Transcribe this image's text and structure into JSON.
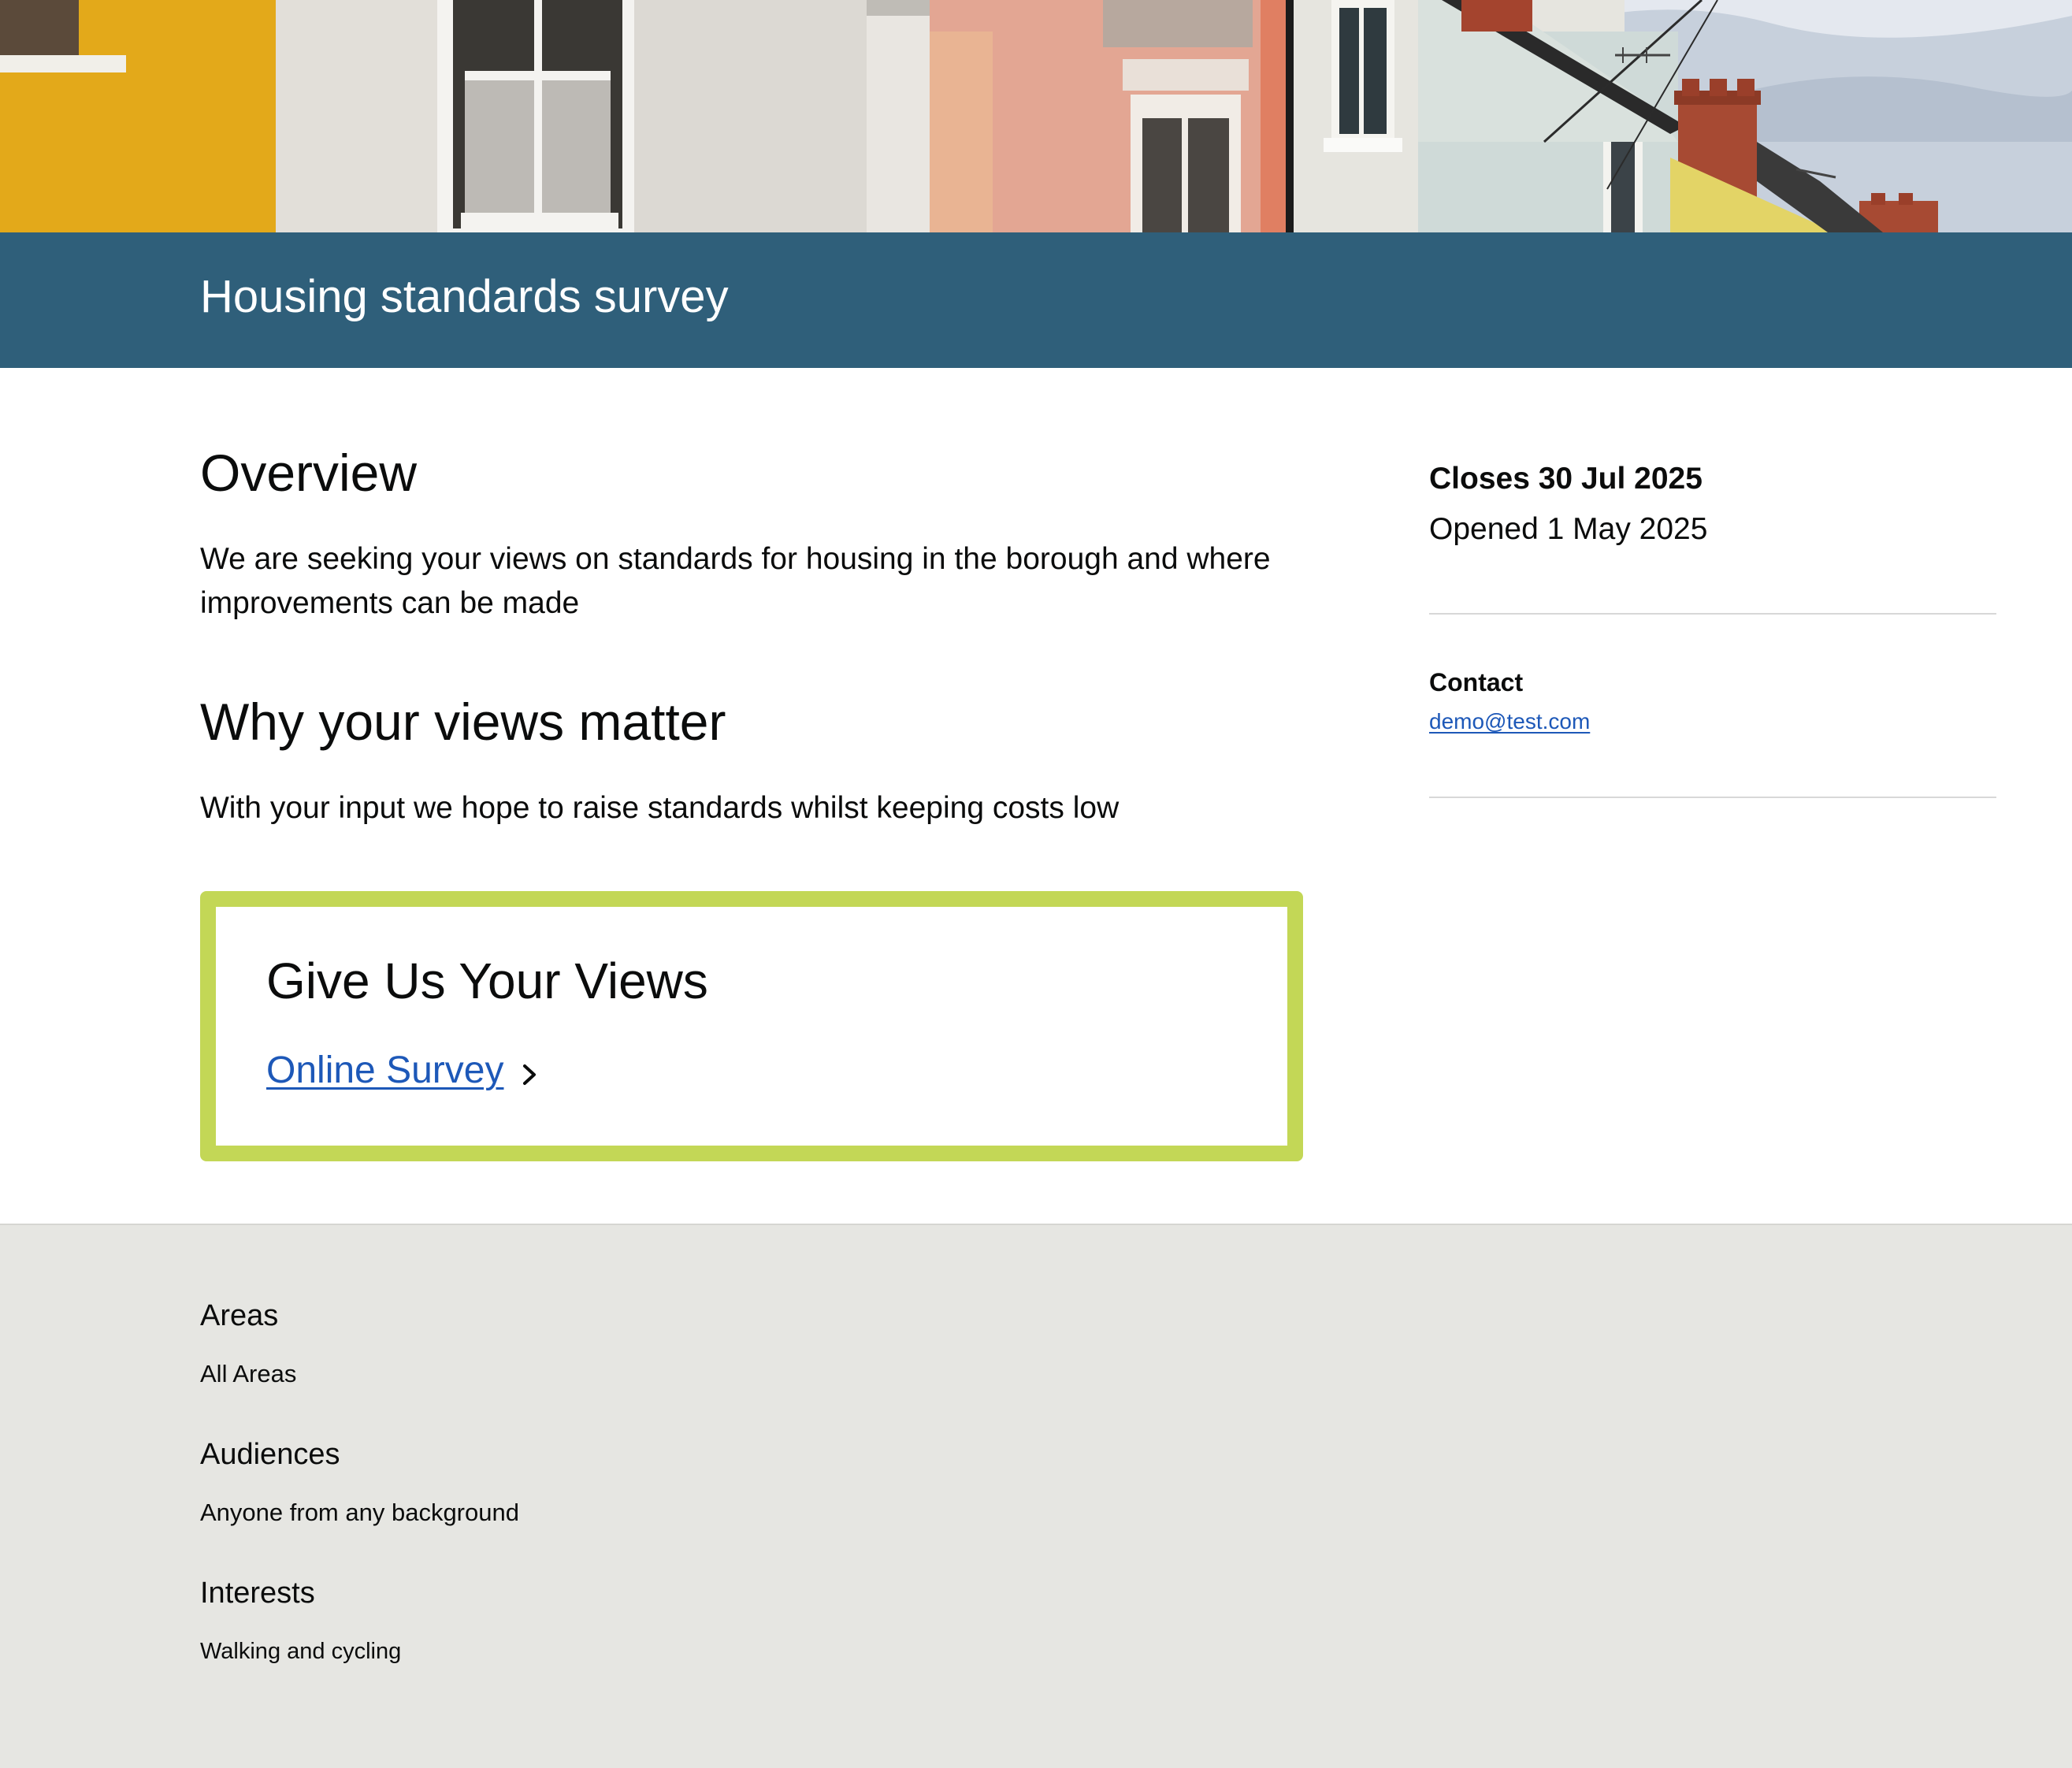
{
  "page": {
    "title": "Housing standards survey"
  },
  "main": {
    "overview_heading": "Overview",
    "overview_text": "We are seeking your views on standards for housing in the borough and where improvements can be made",
    "why_heading": "Why your views matter",
    "why_text": "With your input we hope to raise standards whilst keeping costs low",
    "cta": {
      "heading": "Give Us Your Views",
      "link_label": "Online Survey",
      "link_icon": "chevron-right-icon"
    }
  },
  "sidebar": {
    "closes": "Closes 30 Jul 2025",
    "opened": "Opened 1 May 2025",
    "contact_label": "Contact",
    "contact_email": "demo@test.com"
  },
  "footer": {
    "groups": [
      {
        "title": "Areas",
        "value": "All Areas"
      },
      {
        "title": "Audiences",
        "value": "Anyone from any background"
      },
      {
        "title": "Interests",
        "value": "Walking and cycling"
      }
    ]
  },
  "colors": {
    "title_bar": "#2f5f7a",
    "cta_border": "#c3d756",
    "link": "#1d58b8",
    "footer_bg": "#e6e6e2"
  }
}
